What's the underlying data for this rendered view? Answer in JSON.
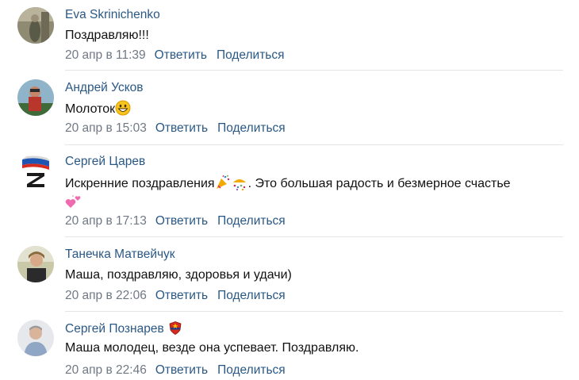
{
  "comments": [
    {
      "author": "Eva Skrinichenko",
      "text": "Поздравляю!!!",
      "date": "20 апр в 11:39",
      "reply_label": "Ответить",
      "share_label": "Поделиться",
      "avatar": "avatar-photo"
    },
    {
      "author": "Андрей Усков",
      "text": "Молоток",
      "text_emoji": "grinning-face-emoji",
      "date": "20 апр в 15:03",
      "reply_label": "Ответить",
      "share_label": "Поделиться",
      "avatar": "avatar-photo"
    },
    {
      "author": "Сергей Царев",
      "text_part1": "Искренние поздравления",
      "text_emojis": [
        "party-popper-emoji",
        "confetti-emoji"
      ],
      "text_part2": ". Это большая радость и безмерное счастье",
      "text_line2_emoji": "heart-emoji",
      "date": "20 апр в 17:13",
      "reply_label": "Ответить",
      "share_label": "Поделиться",
      "avatar": "z-flag-avatar"
    },
    {
      "author": "Танечка Матвейчук",
      "text": "Маша, поздравляю, здоровья и удачи)",
      "date": "20 апр в 22:06",
      "reply_label": "Ответить",
      "share_label": "Поделиться",
      "avatar": "avatar-photo"
    },
    {
      "author": "Сергей Познарев",
      "author_badge": "cska-badge-icon",
      "text": "Маша молодец, везде она успевает. Поздравляю.",
      "date": "20 апр в 22:46",
      "reply_label": "Ответить",
      "share_label": "Поделиться",
      "avatar": "avatar-photo"
    }
  ],
  "colors": {
    "link": "#2a5885",
    "meta": "#6f7985",
    "text": "#111111",
    "divider": "#e3e5e8"
  }
}
